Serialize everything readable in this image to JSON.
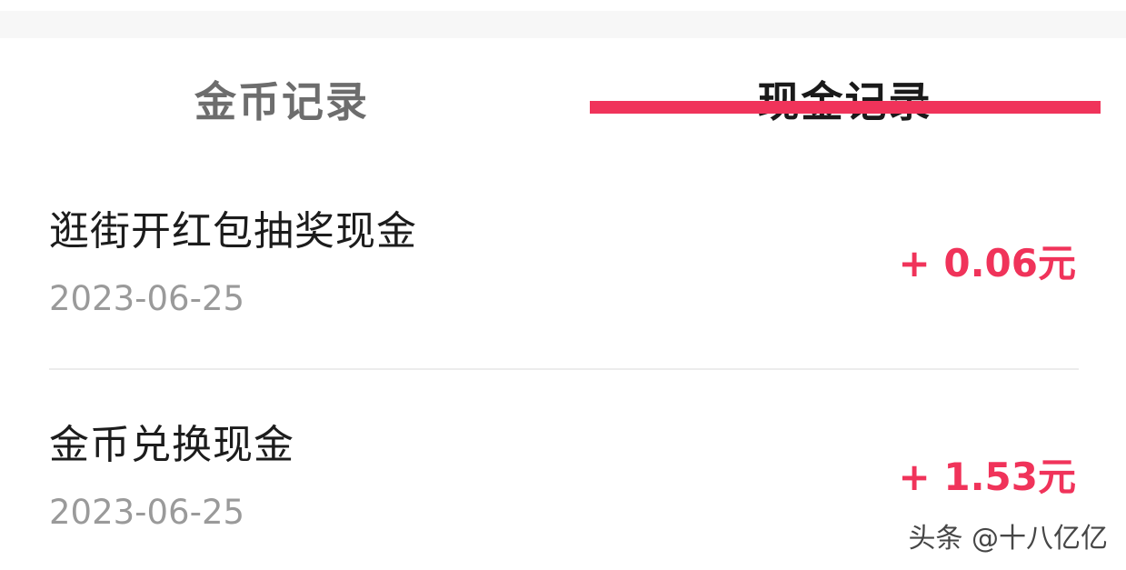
{
  "tabs": [
    {
      "label": "金币记录",
      "active": false
    },
    {
      "label": "现金记录",
      "active": true
    }
  ],
  "accent_color": "#f0335a",
  "records": [
    {
      "title": "逛街开红包抽奖现金",
      "date": "2023-06-25",
      "amount": "+ 0.06元"
    },
    {
      "title": "金币兑换现金",
      "date": "2023-06-25",
      "amount": "+ 1.53元"
    }
  ],
  "watermark": "头条 @十八亿亿"
}
